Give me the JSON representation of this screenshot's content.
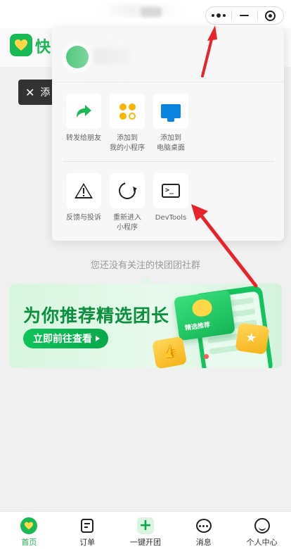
{
  "titlebar": {
    "more_icon": "more-dots-icon",
    "minimize_icon": "minimize-icon",
    "close_icon": "target-close-icon"
  },
  "header": {
    "app_name_peek": "快",
    "toast_text": "添"
  },
  "popup": {
    "row1": [
      {
        "label": "转发给朋友",
        "icon": "share-arrow-icon"
      },
      {
        "label": "添加到\n我的小程序",
        "icon": "mini-program-icon"
      },
      {
        "label": "添加到\n电脑桌面",
        "icon": "desktop-icon"
      }
    ],
    "row2": [
      {
        "label": "反馈与投诉",
        "icon": "warning-icon"
      },
      {
        "label": "重新进入\n小程序",
        "icon": "reload-icon"
      },
      {
        "label": "DevTools",
        "icon": "terminal-icon"
      }
    ]
  },
  "main": {
    "empty_text": "您还没有关注的快团团社群",
    "banner": {
      "title": "为你推荐精选团长",
      "button_label": "立即前往查看",
      "card_label": "精选推荐"
    }
  },
  "tabbar": {
    "items": [
      {
        "label": "首页",
        "icon": "home-icon",
        "active": true
      },
      {
        "label": "订单",
        "icon": "order-icon"
      },
      {
        "label": "一键开团",
        "icon": "plus-icon"
      },
      {
        "label": "消息",
        "icon": "chat-icon"
      },
      {
        "label": "个人中心",
        "icon": "user-icon"
      }
    ]
  },
  "colors": {
    "brand_green": "#19b955",
    "annotation_red": "#e8232b"
  }
}
